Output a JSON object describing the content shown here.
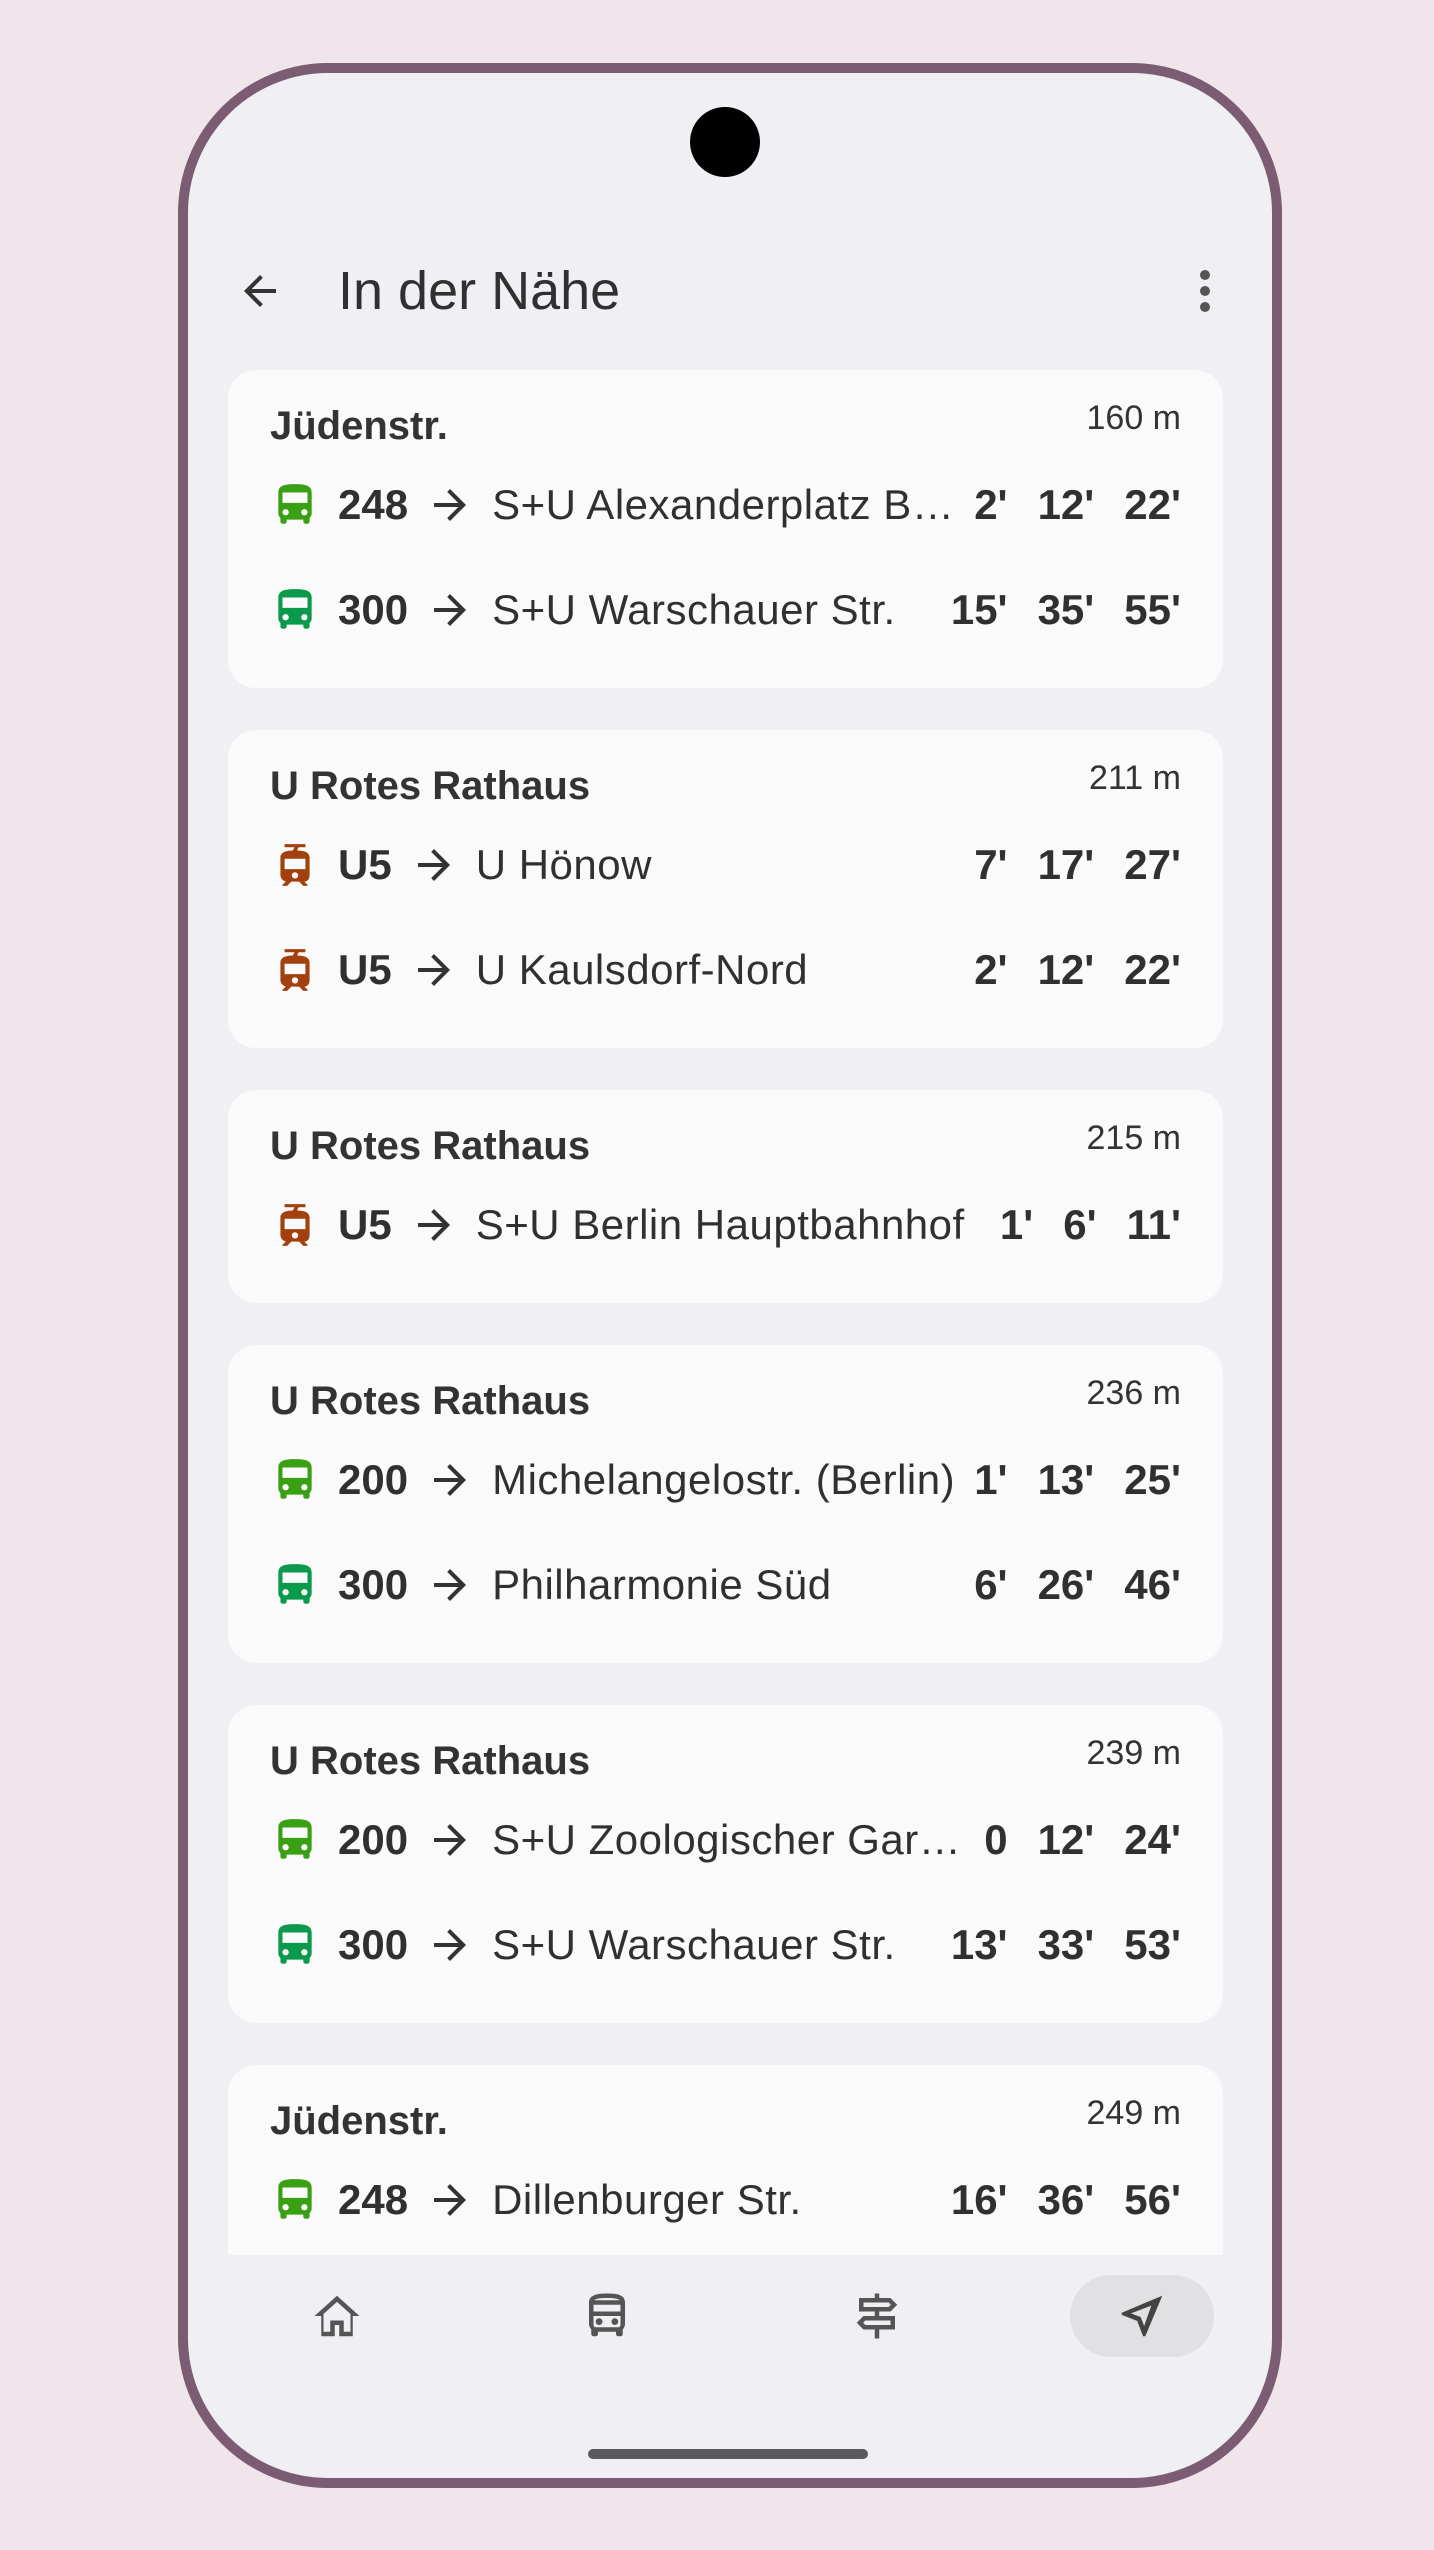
{
  "header": {
    "title": "In der Nähe"
  },
  "colors": {
    "bus_green": "#3aa013",
    "bus_teal": "#0b9a4c",
    "tram_brown": "#a2410e",
    "card_bg": "#fafafa",
    "frame": "#7b5c72"
  },
  "stops": [
    {
      "name": "Jüdenstr.",
      "distance": "160 m",
      "departures": [
        {
          "icon": "bus-icon",
          "color": "#3aa013",
          "line": "248",
          "destination": "S+U Alexanderplatz Bhf/Memhardstr.",
          "times": [
            "2'",
            "12'",
            "22'"
          ]
        },
        {
          "icon": "bus-icon",
          "color": "#0b9a4c",
          "line": "300",
          "destination": "S+U Warschauer Str.",
          "times": [
            "15'",
            "35'",
            "55'"
          ]
        }
      ]
    },
    {
      "name": "U Rotes Rathaus",
      "distance": "211 m",
      "departures": [
        {
          "icon": "tram-icon",
          "color": "#a2410e",
          "line": "U5",
          "destination": "U Hönow",
          "times": [
            "7'",
            "17'",
            "27'"
          ]
        },
        {
          "icon": "tram-icon",
          "color": "#a2410e",
          "line": "U5",
          "destination": "U Kaulsdorf-Nord",
          "times": [
            "2'",
            "12'",
            "22'"
          ]
        }
      ]
    },
    {
      "name": "U Rotes Rathaus",
      "distance": "215 m",
      "departures": [
        {
          "icon": "tram-icon",
          "color": "#a2410e",
          "line": "U5",
          "destination": "S+U Berlin Hauptbahnhof",
          "times": [
            "1'",
            "6'",
            "11'"
          ]
        }
      ]
    },
    {
      "name": "U Rotes Rathaus",
      "distance": "236 m",
      "departures": [
        {
          "icon": "bus-icon",
          "color": "#3aa013",
          "line": "200",
          "destination": "Michelangelostr. (Berlin)",
          "times": [
            "1'",
            "13'",
            "25'"
          ]
        },
        {
          "icon": "bus-icon",
          "color": "#0b9a4c",
          "line": "300",
          "destination": "Philharmonie Süd",
          "times": [
            "6'",
            "26'",
            "46'"
          ]
        }
      ]
    },
    {
      "name": "U Rotes Rathaus",
      "distance": "239 m",
      "departures": [
        {
          "icon": "bus-icon",
          "color": "#3aa013",
          "line": "200",
          "destination": "S+U Zoologischer Garten",
          "times": [
            "0",
            "12'",
            "24'"
          ]
        },
        {
          "icon": "bus-icon",
          "color": "#0b9a4c",
          "line": "300",
          "destination": "S+U Warschauer Str.",
          "times": [
            "13'",
            "33'",
            "53'"
          ]
        }
      ]
    },
    {
      "name": "Jüdenstr.",
      "distance": "249 m",
      "departures": [
        {
          "icon": "bus-icon",
          "color": "#3aa013",
          "line": "248",
          "destination": "Dillenburger Str.",
          "times": [
            "16'",
            "36'",
            "56'"
          ]
        }
      ]
    }
  ],
  "navbar": [
    {
      "name": "home",
      "icon": "home-icon",
      "active": false
    },
    {
      "name": "departures",
      "icon": "bus-icon",
      "active": false
    },
    {
      "name": "directions",
      "icon": "signpost-icon",
      "active": false
    },
    {
      "name": "nearby",
      "icon": "navigation-icon",
      "active": true
    }
  ]
}
